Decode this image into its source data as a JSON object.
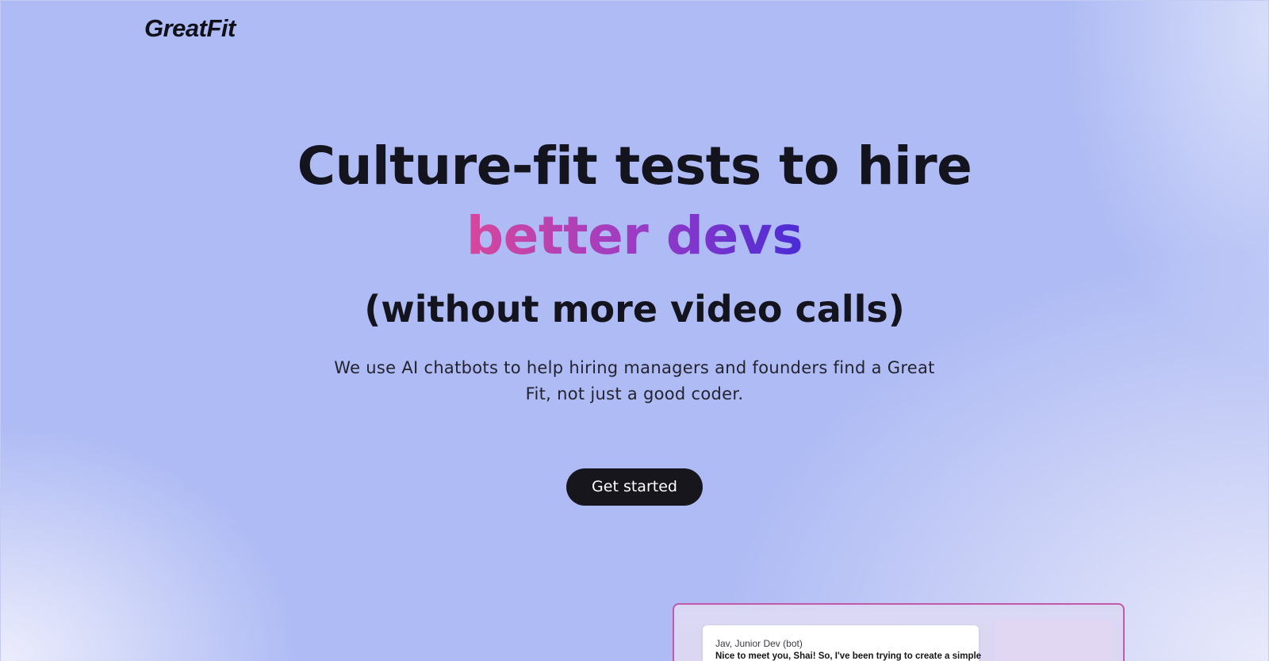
{
  "header": {
    "logo_text": "GreatFit"
  },
  "hero": {
    "headline_line1": "Culture-fit tests to hire",
    "headline_line2": "better devs",
    "headline_line3": "(without more video calls)",
    "description": "We use AI chatbots to help hiring managers and founders find a Great Fit, not just a good coder.",
    "cta_label": "Get started"
  },
  "preview": {
    "chat": {
      "sender": "Jav, Junior Dev (bot)",
      "message": "Nice to meet you, Shai! So, I've been trying to create a simple"
    }
  },
  "colors": {
    "background": "#aebbf4",
    "gradient_start": "#d7479c",
    "gradient_end": "#4a2bd6",
    "cta_background": "#16161c",
    "preview_border": "#c15aa9"
  }
}
